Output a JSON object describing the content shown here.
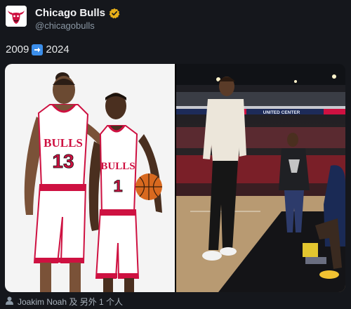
{
  "account": {
    "display_name": "Chicago Bulls",
    "handle": "@chicagobulls",
    "avatar_icon": "bulls-logo-icon",
    "verified_icon": "verified-badge-icon",
    "verified_color": "#e8b019"
  },
  "tweet": {
    "text_before": "2009",
    "arrow_icon": "right-arrow-emoji-icon",
    "text_after": "2024"
  },
  "media": {
    "left_photo": {
      "jersey_left_team": "BULLS",
      "jersey_left_number": "13",
      "jersey_right_team": "BULLS",
      "jersey_right_number": "1"
    },
    "right_photo": {
      "arena_banner": "UNITED CENTER"
    }
  },
  "tagged": {
    "icon": "person-icon",
    "text": "Joakim Noah 及 另外 1 个人"
  },
  "colors": {
    "background": "#15171c",
    "bulls_red": "#ce1141",
    "accent_blue": "#3b8eea"
  }
}
